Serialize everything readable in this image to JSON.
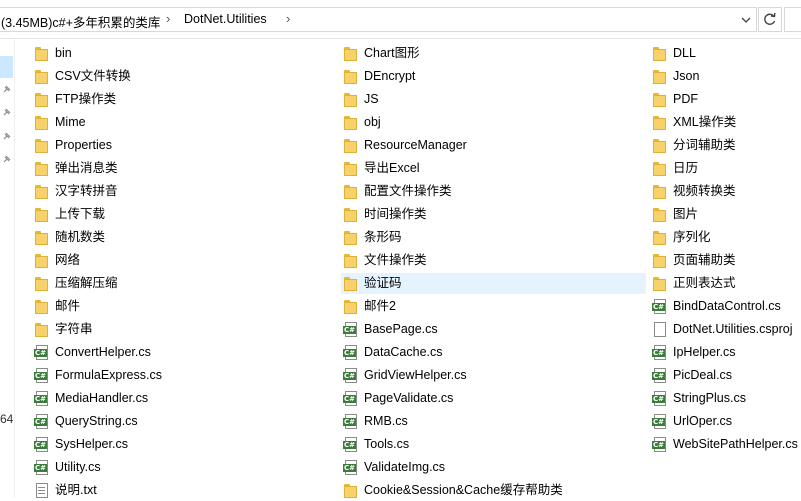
{
  "address": {
    "crumbs": [
      "(3.45MB)c#+多年积累的类库",
      "DotNet.Utilities"
    ],
    "separator": "›"
  },
  "nav_fragment": "64",
  "files": [
    {
      "name": "bin",
      "type": "folder"
    },
    {
      "name": "CSV文件转换",
      "type": "folder"
    },
    {
      "name": "FTP操作类",
      "type": "folder"
    },
    {
      "name": "Mime",
      "type": "folder"
    },
    {
      "name": "Properties",
      "type": "folder"
    },
    {
      "name": "弹出消息类",
      "type": "folder"
    },
    {
      "name": "汉字转拼音",
      "type": "folder"
    },
    {
      "name": "上传下载",
      "type": "folder"
    },
    {
      "name": "随机数类",
      "type": "folder"
    },
    {
      "name": "网络",
      "type": "folder"
    },
    {
      "name": "压缩解压缩",
      "type": "folder"
    },
    {
      "name": "邮件",
      "type": "folder"
    },
    {
      "name": "字符串",
      "type": "folder"
    },
    {
      "name": "ConvertHelper.cs",
      "type": "cs"
    },
    {
      "name": "FormulaExpress.cs",
      "type": "cs"
    },
    {
      "name": "MediaHandler.cs",
      "type": "cs"
    },
    {
      "name": "QueryString.cs",
      "type": "cs"
    },
    {
      "name": "SysHelper.cs",
      "type": "cs"
    },
    {
      "name": "Utility.cs",
      "type": "cs"
    },
    {
      "name": "说明.txt",
      "type": "txt"
    },
    {
      "name": "Chart图形",
      "type": "folder"
    },
    {
      "name": "DEncrypt",
      "type": "folder"
    },
    {
      "name": "JS",
      "type": "folder"
    },
    {
      "name": "obj",
      "type": "folder"
    },
    {
      "name": "ResourceManager",
      "type": "folder"
    },
    {
      "name": "导出Excel",
      "type": "folder"
    },
    {
      "name": "配置文件操作类",
      "type": "folder"
    },
    {
      "name": "时间操作类",
      "type": "folder"
    },
    {
      "name": "条形码",
      "type": "folder"
    },
    {
      "name": "文件操作类",
      "type": "folder"
    },
    {
      "name": "验证码",
      "type": "folder",
      "hovered": true
    },
    {
      "name": "邮件2",
      "type": "folder"
    },
    {
      "name": "BasePage.cs",
      "type": "cs"
    },
    {
      "name": "DataCache.cs",
      "type": "cs"
    },
    {
      "name": "GridViewHelper.cs",
      "type": "cs"
    },
    {
      "name": "PageValidate.cs",
      "type": "cs"
    },
    {
      "name": "RMB.cs",
      "type": "cs"
    },
    {
      "name": "Tools.cs",
      "type": "cs"
    },
    {
      "name": "ValidateImg.cs",
      "type": "cs"
    },
    {
      "name": "Cookie&Session&Cache缓存帮助类",
      "type": "folder"
    },
    {
      "name": "DLL",
      "type": "folder"
    },
    {
      "name": "Json",
      "type": "folder"
    },
    {
      "name": "PDF",
      "type": "folder"
    },
    {
      "name": "XML操作类",
      "type": "folder"
    },
    {
      "name": "分词辅助类",
      "type": "folder"
    },
    {
      "name": "日历",
      "type": "folder"
    },
    {
      "name": "视频转换类",
      "type": "folder"
    },
    {
      "name": "图片",
      "type": "folder"
    },
    {
      "name": "序列化",
      "type": "folder"
    },
    {
      "name": "页面辅助类",
      "type": "folder"
    },
    {
      "name": "正则表达式",
      "type": "folder"
    },
    {
      "name": "BindDataControl.cs",
      "type": "cs"
    },
    {
      "name": "DotNet.Utilities.csproj",
      "type": "csproj"
    },
    {
      "name": "IpHelper.cs",
      "type": "cs"
    },
    {
      "name": "PicDeal.cs",
      "type": "cs"
    },
    {
      "name": "StringPlus.cs",
      "type": "cs"
    },
    {
      "name": "UrlOper.cs",
      "type": "cs"
    },
    {
      "name": "WebSitePathHelper.cs",
      "type": "cs"
    }
  ]
}
